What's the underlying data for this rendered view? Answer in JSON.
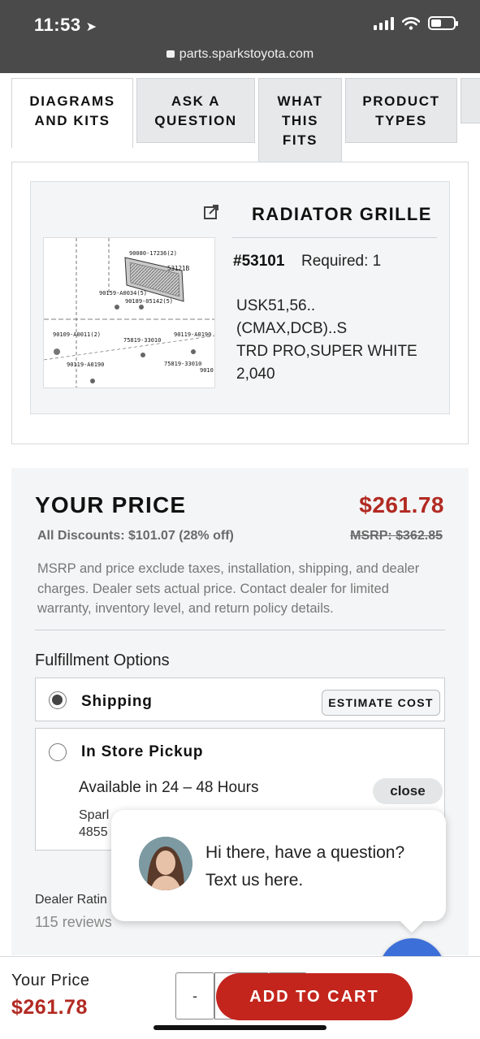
{
  "status_bar": {
    "time": "11:53",
    "url": "parts.sparkstoyota.com"
  },
  "tabs": [
    {
      "label_lines": [
        "DIAGRAMS",
        "AND KITS"
      ],
      "active": true
    },
    {
      "label_lines": [
        "ASK A",
        "QUESTION"
      ],
      "active": false
    },
    {
      "label_lines": [
        "WHAT",
        "THIS",
        "FITS"
      ],
      "active": false
    },
    {
      "label_lines": [
        "PRODUCT",
        "TYPES"
      ],
      "active": false
    }
  ],
  "part": {
    "title": "RADIATOR GRILLE",
    "number": "#53101",
    "required": "Required: 1",
    "description_lines": [
      "USK51,56..",
      "(CMAX,DCB)..S",
      "TRD PRO,SUPER WHITE",
      "2,040"
    ],
    "diagram_labels": {
      "l1": "90080-17236(2)",
      "l2": "53121B",
      "l3": "90159-A0034(5)",
      "l4": "90189-05142(5)",
      "l5": "90109-A0011(2)",
      "l6": "75819-33010",
      "l7": "90119-A0190",
      "l8": "90119-A0190",
      "l9": "75819-33010",
      "l10": "9010"
    }
  },
  "pricing": {
    "your_price_label": "YOUR PRICE",
    "your_price": "$261.78",
    "discounts": "All Discounts: $101.07 (28% off)",
    "msrp": "MSRP: $362.85",
    "disclaimer": "MSRP and price exclude taxes, installation, shipping, and dealer charges. Dealer sets actual price. Contact dealer for limited warranty, inventory level, and return policy details."
  },
  "fulfillment": {
    "label": "Fulfillment Options",
    "shipping_label": "Shipping",
    "estimate_cost": "ESTIMATE COST",
    "pickup_label": "In Store Pickup",
    "availability": "Available in 24 – 48 Hours",
    "close": "close",
    "store_line1": "Sparl",
    "store_line2": "4855"
  },
  "dealer": {
    "rating_label": "Dealer Ratin",
    "reviews": "115 reviews"
  },
  "chat": {
    "message": "Hi there, have a question? Text us here."
  },
  "bottom_bar": {
    "label": "Your Price",
    "price": "$261.78",
    "qty_minus": "-",
    "add_to_cart": "ADD TO CART"
  },
  "colors": {
    "accent_red": "#b22a22",
    "button_red": "#c3251d",
    "chat_blue": "#3d6fd8",
    "status_bar": "#4a4a4a"
  }
}
